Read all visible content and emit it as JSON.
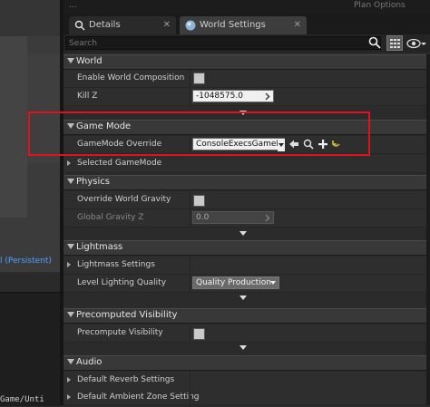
{
  "left": {
    "persistent_label": "l (Persistent)",
    "bottom_text": "Game/Unti"
  },
  "topband": {
    "left_text": "...",
    "right_text": "Plan Options"
  },
  "tabs": [
    {
      "label": "Details",
      "icon": "details-icon"
    },
    {
      "label": "World Settings",
      "icon": "globe-icon"
    }
  ],
  "search": {
    "placeholder": "Search",
    "value": ""
  },
  "sections": {
    "world": {
      "title": "World",
      "enable_world_composition": {
        "label": "Enable World Composition",
        "checked": false
      },
      "kill_z": {
        "label": "Kill Z",
        "value": "-1048575.0"
      }
    },
    "game_mode": {
      "title": "Game Mode",
      "gamemode_override": {
        "label": "GameMode Override",
        "value": "ConsoleExecsGameMode"
      },
      "selected_gamemode": {
        "label": "Selected GameMode"
      }
    },
    "physics": {
      "title": "Physics",
      "override_world_gravity": {
        "label": "Override World Gravity",
        "checked": false
      },
      "global_gravity_z": {
        "label": "Global Gravity Z",
        "value": "0.0"
      }
    },
    "lightmass": {
      "title": "Lightmass",
      "lightmass_settings": {
        "label": "Lightmass Settings"
      },
      "level_lighting_quality": {
        "label": "Level Lighting Quality",
        "value": "Quality Production"
      }
    },
    "precomputed_visibility": {
      "title": "Precomputed Visibility",
      "precompute_visibility": {
        "label": "Precompute Visibility",
        "checked": false
      }
    },
    "audio": {
      "title": "Audio",
      "default_reverb_settings": {
        "label": "Default Reverb Settings"
      },
      "default_ambient_zone_settings": {
        "label": "Default Ambient Zone Setting"
      }
    }
  },
  "colors": {
    "highlight": "#e0121b",
    "link_blue": "#4fa3ff",
    "reset_arrow": "#d8c13a"
  }
}
